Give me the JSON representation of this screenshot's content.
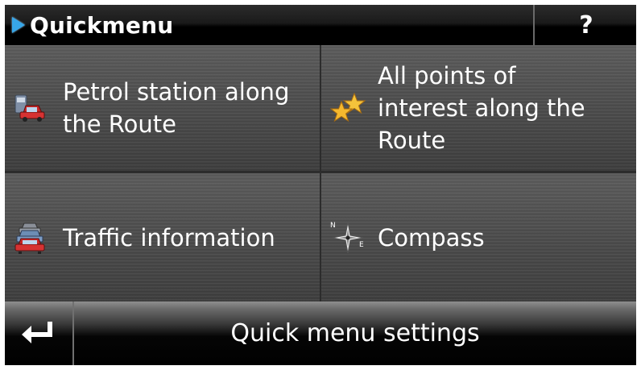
{
  "header": {
    "title": "Quickmenu",
    "help_label": "?"
  },
  "tiles": [
    {
      "label_lines": [
        "Petrol station along",
        "the Route"
      ],
      "icon": "petrol-station-car-icon"
    },
    {
      "label_lines": [
        "All points of",
        "interest along the",
        "Route"
      ],
      "icon": "stars-icon"
    },
    {
      "label_lines": [
        "Traffic information"
      ],
      "icon": "traffic-cars-icon"
    },
    {
      "label_lines": [
        "Compass"
      ],
      "icon": "compass-icon"
    }
  ],
  "compass_letters": {
    "north": "N",
    "east": "E"
  },
  "bottom": {
    "back_icon": "return-arrow-icon",
    "settings_label": "Quick menu settings"
  },
  "colors": {
    "accent": "#37a6e8",
    "text": "#ffffff",
    "star": "#f5b82e"
  }
}
